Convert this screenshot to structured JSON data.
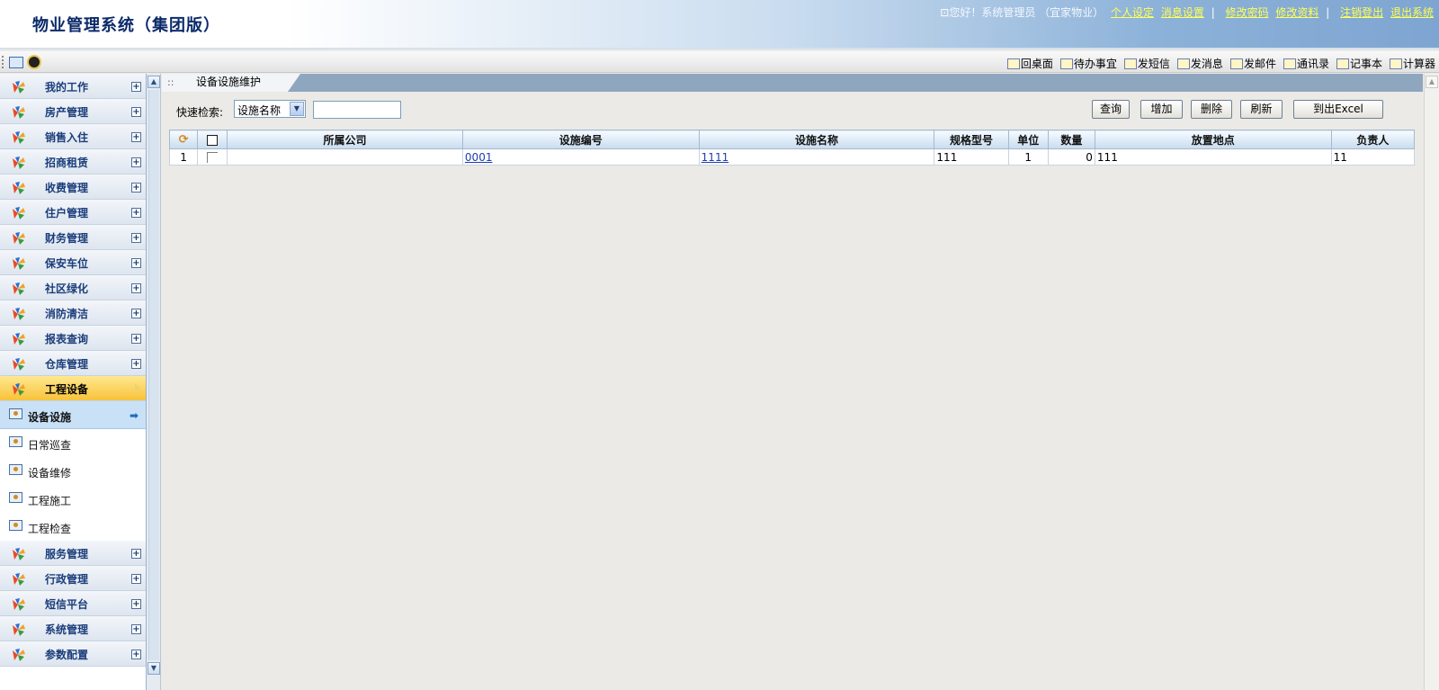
{
  "header": {
    "title": "物业管理系统（集团版）",
    "greeting": "您好！系统管理员 （宜家物业）",
    "links": [
      "个人设定",
      "消息设置",
      "修改密码",
      "修改资料",
      "注销登出",
      "退出系统"
    ],
    "separator": "|"
  },
  "toolbar": {
    "tools": [
      {
        "label": "回桌面",
        "icon": "home-icon"
      },
      {
        "label": "待办事宜",
        "icon": "todo-icon"
      },
      {
        "label": "发短信",
        "icon": "sms-icon"
      },
      {
        "label": "发消息",
        "icon": "message-icon"
      },
      {
        "label": "发邮件",
        "icon": "mail-icon"
      },
      {
        "label": "通讯录",
        "icon": "contacts-icon"
      },
      {
        "label": "记事本",
        "icon": "notepad-icon"
      },
      {
        "label": "计算器",
        "icon": "calculator-icon"
      }
    ]
  },
  "sidebar": {
    "menu_top": [
      "我的工作",
      "房产管理",
      "销售入住",
      "招商租赁",
      "收费管理",
      "住户管理",
      "财务管理",
      "保安车位",
      "社区绿化",
      "消防清洁",
      "报表查询",
      "仓库管理"
    ],
    "active_menu": "工程设备",
    "sub_items": [
      "设备设施",
      "日常巡查",
      "设备维修",
      "工程施工",
      "工程检查"
    ],
    "selected_sub": "设备设施",
    "menu_bottom": [
      "服务管理",
      "行政管理",
      "短信平台",
      "系统管理",
      "参数配置"
    ],
    "plus_symbol": "+"
  },
  "main": {
    "tab_label": "设备设施维护",
    "search": {
      "label": "快速检索:",
      "field_value": "设施名称",
      "input_value": ""
    },
    "buttons": [
      "查询",
      "增加",
      "删除",
      "刷新",
      "到出Excel"
    ],
    "table": {
      "columns": [
        "所属公司",
        "设施编号",
        "设施名称",
        "规格型号",
        "单位",
        "数量",
        "放置地点",
        "负责人"
      ],
      "rows": [
        {
          "index": "1",
          "company": "",
          "code": "0001",
          "name": "1111",
          "spec": "111",
          "unit": "1",
          "qty": "0",
          "location": "111",
          "owner": "11"
        }
      ]
    }
  },
  "colors": {
    "header_gradient_end": "#7ea5d1",
    "sidebar_label": "#1a3d7a",
    "active_menu": "#f8c23a",
    "selected_sub": "#c8e1f7",
    "link_yellow": "#ffff55",
    "table_link": "#1d3fb0"
  }
}
